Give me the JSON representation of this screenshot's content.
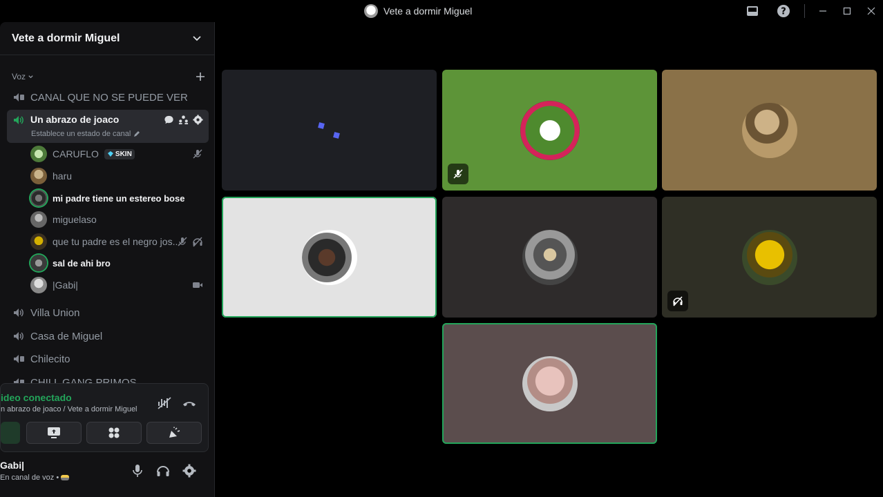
{
  "window": {
    "title": "Vete a dormir Miguel"
  },
  "server": {
    "name": "Vete a dormir Miguel"
  },
  "category": {
    "label": "Voz"
  },
  "channels": {
    "hidden": "CANAL QUE NO SE PUEDE VER",
    "active": {
      "name": "Un abrazo de joaco",
      "status_hint": "Establece un estado de canal"
    },
    "others": [
      "Villa Union",
      "Casa de Miguel",
      "Chilecito",
      "CHILL GANG PRIMOS"
    ]
  },
  "members": [
    {
      "name": "CARUFLO",
      "badge": "SKIN"
    },
    {
      "name": "haru"
    },
    {
      "name": "mi padre tiene un estereo bose"
    },
    {
      "name": "miguelaso"
    },
    {
      "name": "que tu padre es el negro jos..."
    },
    {
      "name": "sal de ahi bro"
    },
    {
      "name": "|Gabi|"
    }
  ],
  "voice": {
    "status": "ideo conectado",
    "location": "n abrazo de joaco / Vete a dormir Miguel"
  },
  "user": {
    "name": "Gabi|",
    "status": "En canal de voz •"
  },
  "colors": {
    "accent_green": "#23a55a",
    "tile_green": "#5d9438",
    "tile_tan": "#8a7148",
    "tile_light": "#e3e3e3",
    "tile_brown": "#5b4d4d"
  }
}
